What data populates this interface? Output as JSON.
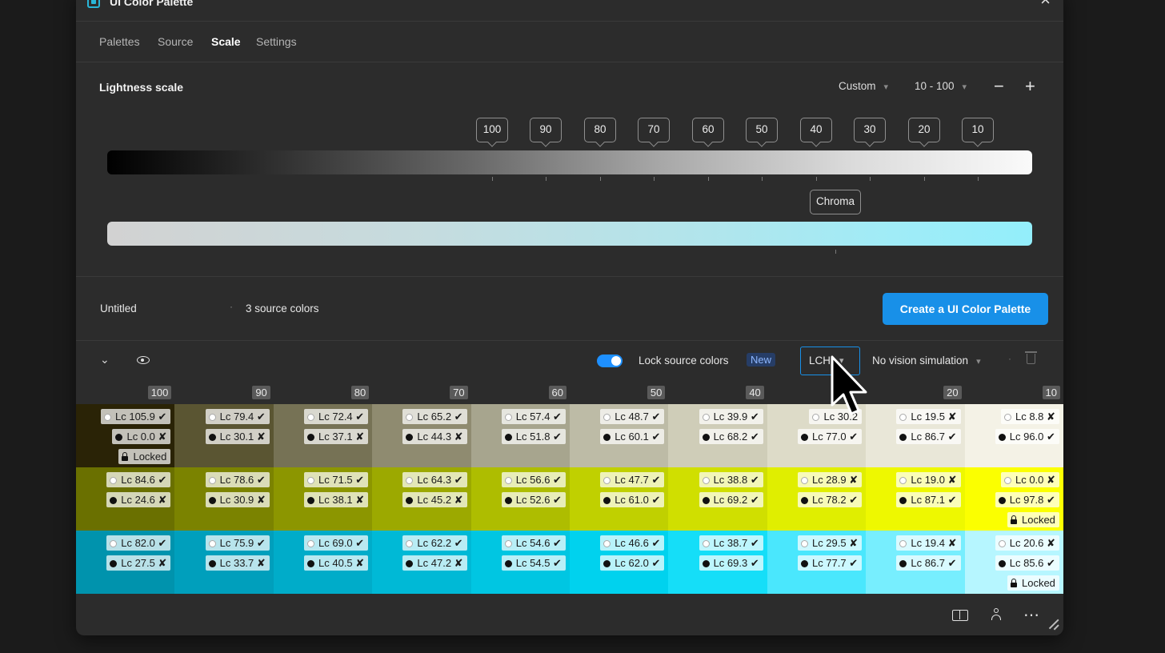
{
  "app": {
    "title": "UI Color Palette",
    "close_icon": "×"
  },
  "tabs": [
    {
      "label": "Palettes"
    },
    {
      "label": "Source"
    },
    {
      "label": "Scale"
    },
    {
      "label": "Settings"
    }
  ],
  "active_tab": "Scale",
  "scale": {
    "title": "Lightness scale",
    "preset": "Custom",
    "range": "10 - 100",
    "minus_icon": "−",
    "plus_icon": "+",
    "stops": [
      "100",
      "90",
      "80",
      "70",
      "60",
      "50",
      "40",
      "30",
      "20",
      "10"
    ],
    "chroma_label": "Chroma"
  },
  "palette": {
    "name": "Untitled",
    "source_count": "3 source colors",
    "create_button": "Create a UI Color Palette"
  },
  "toolbar": {
    "lock_label": "Lock source colors",
    "lock_enabled": true,
    "new_badge": "New",
    "color_space": "LCH",
    "vision": "No vision simulation"
  },
  "grid_headers": [
    "100",
    "90",
    "80",
    "70",
    "60",
    "50",
    "40",
    "30",
    "20",
    "10"
  ],
  "grid_visible_headers": [
    "100",
    "90",
    "80",
    "70",
    "60",
    "50",
    "40",
    "",
    "20",
    "10"
  ],
  "locked_label": "Locked",
  "rows": [
    {
      "colors": [
        "#2a2306",
        "#5a5532",
        "#767255",
        "#8f8b70",
        "#a7a58e",
        "#bdbba6",
        "#cfcdb8",
        "#dddbc8",
        "#e9e7d8",
        "#f4f2e6"
      ],
      "white": [
        "Lc 105.9 ✔",
        "Lc 79.4 ✔",
        "Lc 72.4 ✔",
        "Lc 65.2 ✔",
        "Lc 57.4 ✔",
        "Lc 48.7 ✔",
        "Lc 39.9 ✔",
        "Lc 30.2",
        "Lc 19.5 ✘",
        "Lc 8.8 ✘"
      ],
      "black": [
        "Lc 0.0 ✘",
        "Lc 30.1 ✘",
        "Lc 37.1 ✘",
        "Lc 44.3 ✘",
        "Lc 51.8 ✔",
        "Lc 60.1 ✔",
        "Lc 68.2 ✔",
        "Lc 77.0 ✔",
        "Lc 86.7 ✔",
        "Lc 96.0 ✔"
      ],
      "locked_index": 0
    },
    {
      "colors": [
        "#6a7000",
        "#7b8300",
        "#8c9600",
        "#9ca900",
        "#aebd00",
        "#c0d000",
        "#d0df00",
        "#e0ee00",
        "#eef800",
        "#fbff00"
      ],
      "white": [
        "Lc 84.6 ✔",
        "Lc 78.6 ✔",
        "Lc 71.5 ✔",
        "Lc 64.3 ✔",
        "Lc 56.6 ✔",
        "Lc 47.7 ✔",
        "Lc 38.8 ✔",
        "Lc 28.9 ✘",
        "Lc 19.0 ✘",
        "Lc 0.0 ✘"
      ],
      "black": [
        "Lc 24.6 ✘",
        "Lc 30.9 ✘",
        "Lc 38.1 ✘",
        "Lc 45.2 ✘",
        "Lc 52.6 ✔",
        "Lc 61.0 ✔",
        "Lc 69.2 ✔",
        "Lc 78.2 ✔",
        "Lc 87.1 ✔",
        "Lc 97.8 ✔"
      ],
      "locked_index": 9
    },
    {
      "colors": [
        "#0093ad",
        "#009fbc",
        "#00acc9",
        "#00b9d6",
        "#00c6e2",
        "#00d2ee",
        "#15def8",
        "#4ae7fd",
        "#77eefe",
        "#b6f6ff"
      ],
      "white": [
        "Lc 82.0 ✔",
        "Lc 75.9 ✔",
        "Lc 69.0 ✔",
        "Lc 62.2 ✔",
        "Lc 54.6 ✔",
        "Lc 46.6 ✔",
        "Lc 38.7 ✔",
        "Lc 29.5 ✘",
        "Lc 19.4 ✘",
        "Lc 20.6 ✘"
      ],
      "black": [
        "Lc 27.5 ✘",
        "Lc 33.7 ✘",
        "Lc 40.5 ✘",
        "Lc 47.2 ✘",
        "Lc 54.5 ✔",
        "Lc 62.0 ✔",
        "Lc 69.3 ✔",
        "Lc 77.7 ✔",
        "Lc 86.7 ✔",
        "Lc 85.6 ✔"
      ],
      "locked_index": 9
    }
  ],
  "footer": {
    "more_icon": "⋯"
  },
  "colors": {
    "accent": "#1890e8",
    "window_bg": "#2c2c2c",
    "page_bg": "#1b1b1b"
  }
}
